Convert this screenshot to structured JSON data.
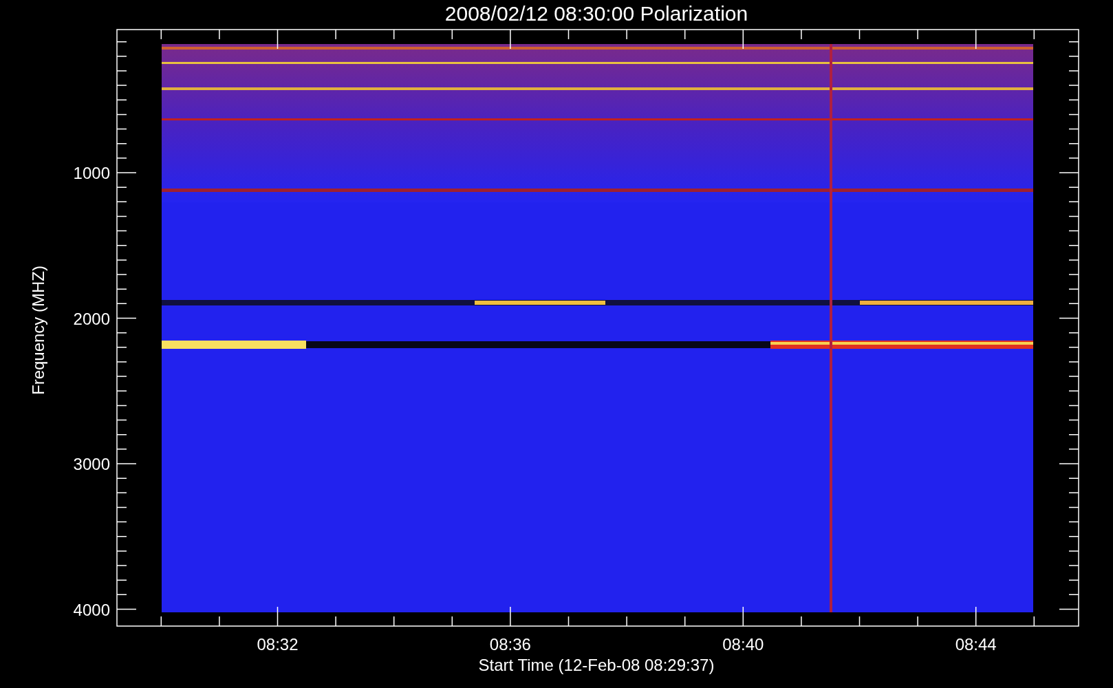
{
  "title": "2008/02/12 08:30:00 Polarization",
  "y_axis": {
    "label": "Frequency (MHZ)",
    "ticks": [
      "1000",
      "2000",
      "3000",
      "4000"
    ]
  },
  "x_axis": {
    "label": "Start Time (12-Feb-08 08:29:37)",
    "ticks": [
      "08:32",
      "08:36",
      "08:40",
      "08:44"
    ]
  }
}
